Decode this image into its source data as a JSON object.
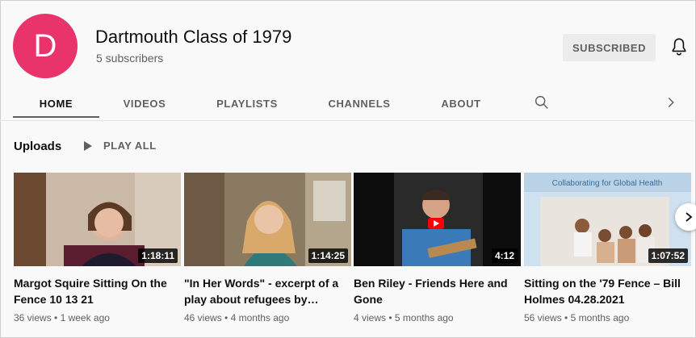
{
  "channel": {
    "avatar_letter": "D",
    "avatar_color": "#e8336b",
    "name": "Dartmouth Class of 1979",
    "subscribers": "5 subscribers",
    "subscribe_label": "SUBSCRIBED",
    "bell_icon": "bell-icon"
  },
  "tabs": [
    {
      "label": "HOME",
      "active": true
    },
    {
      "label": "VIDEOS",
      "active": false
    },
    {
      "label": "PLAYLISTS",
      "active": false
    },
    {
      "label": "CHANNELS",
      "active": false
    },
    {
      "label": "ABOUT",
      "active": false
    }
  ],
  "tab_icons": {
    "search": "search-icon",
    "next": "chevron-right-icon"
  },
  "uploads": {
    "title": "Uploads",
    "play_all": "PLAY ALL",
    "videos": [
      {
        "title": "Margot Squire Sitting On the Fence 10 13 21",
        "duration": "1:18:11",
        "views": "36 views",
        "age": "1 week ago"
      },
      {
        "title": "\"In Her Words\" - excerpt of a play about refugees by…",
        "duration": "1:14:25",
        "views": "46 views",
        "age": "4 months ago"
      },
      {
        "title": "Ben Riley - Friends Here and Gone",
        "duration": "4:12",
        "views": "4 views",
        "age": "5 months ago"
      },
      {
        "title": "Sitting on the '79 Fence – Bill Holmes 04.28.2021",
        "duration": "1:07:52",
        "views": "56 views",
        "age": "5 months ago"
      }
    ],
    "thumb4_banner": "Collaborating for Global Health",
    "meta_separator": " • "
  },
  "colors": {
    "background": "#f9f9f9",
    "secondary_text": "#606060",
    "youtube_red": "#ff0000"
  }
}
